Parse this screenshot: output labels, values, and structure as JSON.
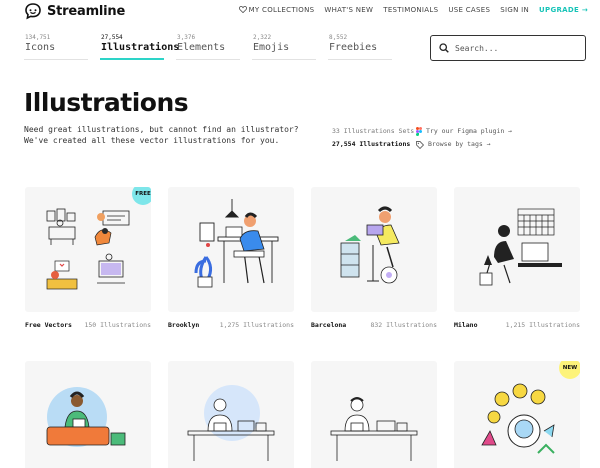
{
  "header": {
    "logo_text": "Streamline",
    "nav": {
      "collections": "MY COLLECTIONS",
      "whats_new": "WHAT'S NEW",
      "testimonials": "TESTIMONIALS",
      "use_cases": "USE CASES",
      "sign_in": "SIGN IN",
      "upgrade": "UPGRADE →"
    }
  },
  "tabs": [
    {
      "count": "134,751",
      "label": "Icons"
    },
    {
      "count": "27,554",
      "label": "Illustrations"
    },
    {
      "count": "3,376",
      "label": "Elements"
    },
    {
      "count": "2,322",
      "label": "Emojis"
    },
    {
      "count": "8,552",
      "label": "Freebies"
    }
  ],
  "search": {
    "placeholder": "Search..."
  },
  "page": {
    "title": "Illustrations",
    "description": "Need great illustrations, but cannot find an illustrator? We've created all these vector illustrations for you.",
    "sets_count": "33 Illustrations Sets",
    "illus_count": "27,554 Illustrations",
    "figma_link": "Try our Figma plugin →",
    "tags_link": "Browse by tags →"
  },
  "cards": [
    {
      "name": "Free Vectors",
      "count": "150 Illustrations",
      "badge": "FREE"
    },
    {
      "name": "Brooklyn",
      "count": "1,275 Illustrations"
    },
    {
      "name": "Barcelona",
      "count": "832 Illustrations"
    },
    {
      "name": "Milano",
      "count": "1,215 Illustrations"
    },
    {
      "name": "",
      "count": ""
    },
    {
      "name": "",
      "count": ""
    },
    {
      "name": "",
      "count": ""
    },
    {
      "name": "",
      "count": "",
      "badge": "NEW"
    }
  ],
  "colors": {
    "accent": "#2dd4c8",
    "upgrade": "#18c4b8",
    "free_badge": "#7ee6ea",
    "new_badge": "#fdf37a"
  }
}
